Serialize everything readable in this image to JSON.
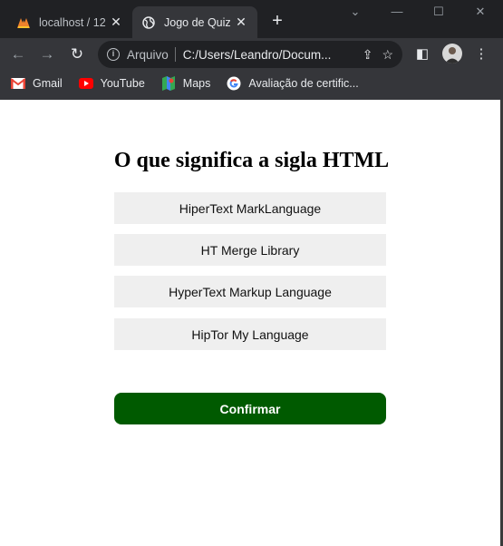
{
  "browser": {
    "tabs": [
      {
        "title": "localhost / 12",
        "favicon": "xampp-icon",
        "active": false
      },
      {
        "title": "Jogo de Quiz",
        "favicon": "globe-icon",
        "active": true
      }
    ],
    "new_tab_label": "+",
    "address": {
      "scheme_label": "Arquivo",
      "url": "C:/Users/Leandro/Docum..."
    },
    "bookmarks": [
      {
        "label": "Gmail",
        "icon": "gmail-icon"
      },
      {
        "label": "YouTube",
        "icon": "youtube-icon"
      },
      {
        "label": "Maps",
        "icon": "maps-icon"
      },
      {
        "label": "Avaliação de certific...",
        "icon": "google-icon"
      }
    ]
  },
  "quiz": {
    "question": "O que significa a sigla HTML",
    "answers": [
      "HiperText MarkLanguage",
      "HT Merge Library",
      "HyperText Markup Language",
      "HipTor My Language"
    ],
    "confirm_label": "Confirmar"
  },
  "colors": {
    "confirm_bg": "#005a00",
    "answer_bg": "#efefef",
    "chrome_dark": "#202124",
    "chrome_toolbar": "#35363a"
  }
}
